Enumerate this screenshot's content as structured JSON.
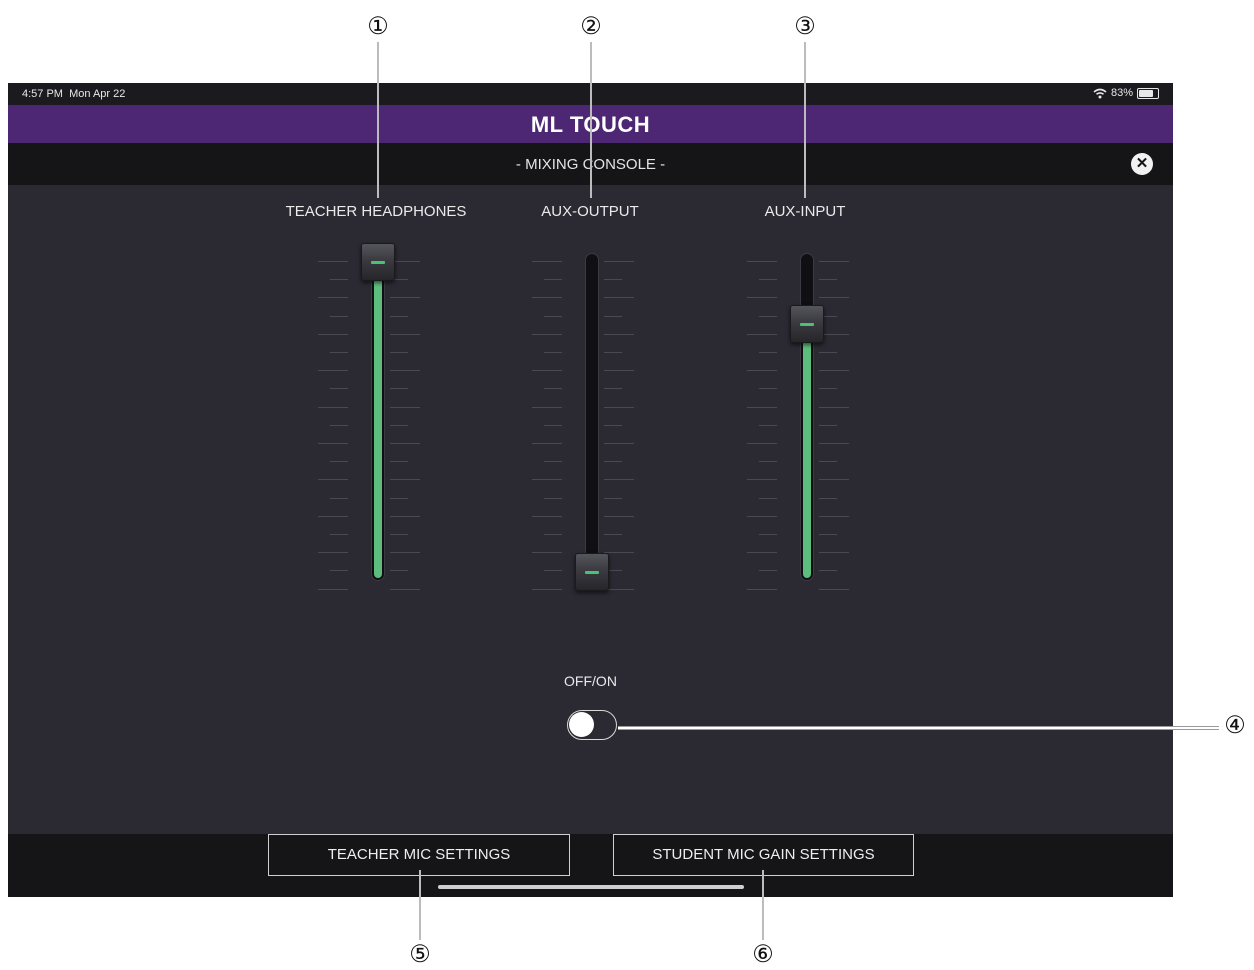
{
  "status_bar": {
    "time": "4:57 PM",
    "date": "Mon Apr 22",
    "battery_pct": "83%",
    "battery_level": 0.83,
    "wifi_icon": "wifi-icon"
  },
  "app": {
    "title": "ML TOUCH",
    "subtitle": "- MIXING CONSOLE -",
    "close_icon": "close-icon"
  },
  "channels": [
    {
      "label": "TEACHER HEADPHONES",
      "level": 1.0
    },
    {
      "label": "AUX-OUTPUT",
      "level": 0.0
    },
    {
      "label": "AUX-INPUT",
      "level": 0.8
    }
  ],
  "power": {
    "label": "OFF/ON",
    "state": "off"
  },
  "buttons": {
    "teacher_mic": "TEACHER MIC SETTINGS",
    "student_mic": "STUDENT MIC GAIN SETTINGS"
  },
  "callouts": [
    "①",
    "②",
    "③",
    "④",
    "⑤",
    "⑥"
  ],
  "colors": {
    "header": "#4e2774",
    "background": "#2b2a33",
    "level_fill": "#5cbd7e"
  }
}
